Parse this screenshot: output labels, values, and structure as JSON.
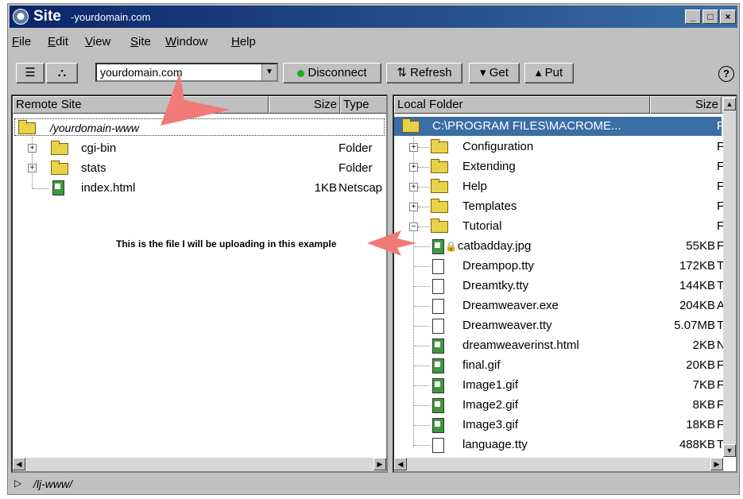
{
  "window": {
    "title": "Site",
    "domain": "yourdomain.com"
  },
  "menu": [
    {
      "label": "File",
      "u": "F",
      "rest": "ile"
    },
    {
      "label": "Edit",
      "u": "E",
      "rest": "dit"
    },
    {
      "label": "View",
      "u": "V",
      "rest": "iew"
    },
    {
      "label": "Site",
      "u": "S",
      "rest": "ite"
    },
    {
      "label": "Window",
      "u": "W",
      "rest": "indow"
    },
    {
      "label": "Help",
      "u": "H",
      "rest": "elp"
    }
  ],
  "toolbar": {
    "site_select_value": "yourdomain.com",
    "disconnect_label": "Disconnect",
    "refresh_label": "Refresh",
    "get_label": "Get",
    "put_label": "Put",
    "help_glyph": "?"
  },
  "remote": {
    "headers": {
      "name": "Remote Site",
      "size": "Size",
      "type": "Type"
    },
    "root": "/yourdomain-www",
    "items": [
      {
        "name": "cgi-bin",
        "size": "",
        "type": "Folder",
        "icon": "folder-icon"
      },
      {
        "name": "stats",
        "size": "",
        "type": "Folder",
        "icon": "folder-icon"
      },
      {
        "name": "index.html",
        "size": "1KB",
        "type": "Netscap",
        "icon": "html-file-icon"
      }
    ]
  },
  "local": {
    "headers": {
      "name": "Local Folder",
      "size": "Size"
    },
    "root": "C:\\PROGRAM FILES\\MACROME...",
    "root_type": "F",
    "folders": [
      {
        "name": "Configuration",
        "type": "F"
      },
      {
        "name": "Extending",
        "type": "F"
      },
      {
        "name": "Help",
        "type": "F"
      },
      {
        "name": "Templates",
        "type": "F"
      },
      {
        "name": "Tutorial",
        "type": "F"
      }
    ],
    "files": [
      {
        "name": "catbadday.jpg",
        "size": "55KB",
        "type": "F",
        "icon": "image-file-icon"
      },
      {
        "name": "Dreampop.tty",
        "size": "172KB",
        "type": "T",
        "icon": "document-icon"
      },
      {
        "name": "Dreamtky.tty",
        "size": "144KB",
        "type": "T",
        "icon": "document-icon"
      },
      {
        "name": "Dreamweaver.exe",
        "size": "204KB",
        "type": "A",
        "icon": "document-icon"
      },
      {
        "name": "Dreamweaver.tty",
        "size": "5.07MB",
        "type": "T",
        "icon": "document-icon"
      },
      {
        "name": "dreamweaverinst.html",
        "size": "2KB",
        "type": "N",
        "icon": "html-file-icon"
      },
      {
        "name": "final.gif",
        "size": "20KB",
        "type": "F",
        "icon": "image-file-icon"
      },
      {
        "name": "Image1.gif",
        "size": "7KB",
        "type": "F",
        "icon": "image-file-icon"
      },
      {
        "name": "Image2.gif",
        "size": "8KB",
        "type": "F",
        "icon": "image-file-icon"
      },
      {
        "name": "Image3.gif",
        "size": "18KB",
        "type": "F",
        "icon": "image-file-icon"
      },
      {
        "name": "language.tty",
        "size": "488KB",
        "type": "T",
        "icon": "document-icon"
      }
    ]
  },
  "annotation": "This is the file I will be uploading in this example",
  "status": {
    "path": "/lj-www/"
  },
  "colors": {
    "title_start": "#0a246a",
    "title_end": "#3a6ea5",
    "selection": "#3a6ea5",
    "arrow": "#f07a78",
    "folder": "#e8d24a"
  }
}
